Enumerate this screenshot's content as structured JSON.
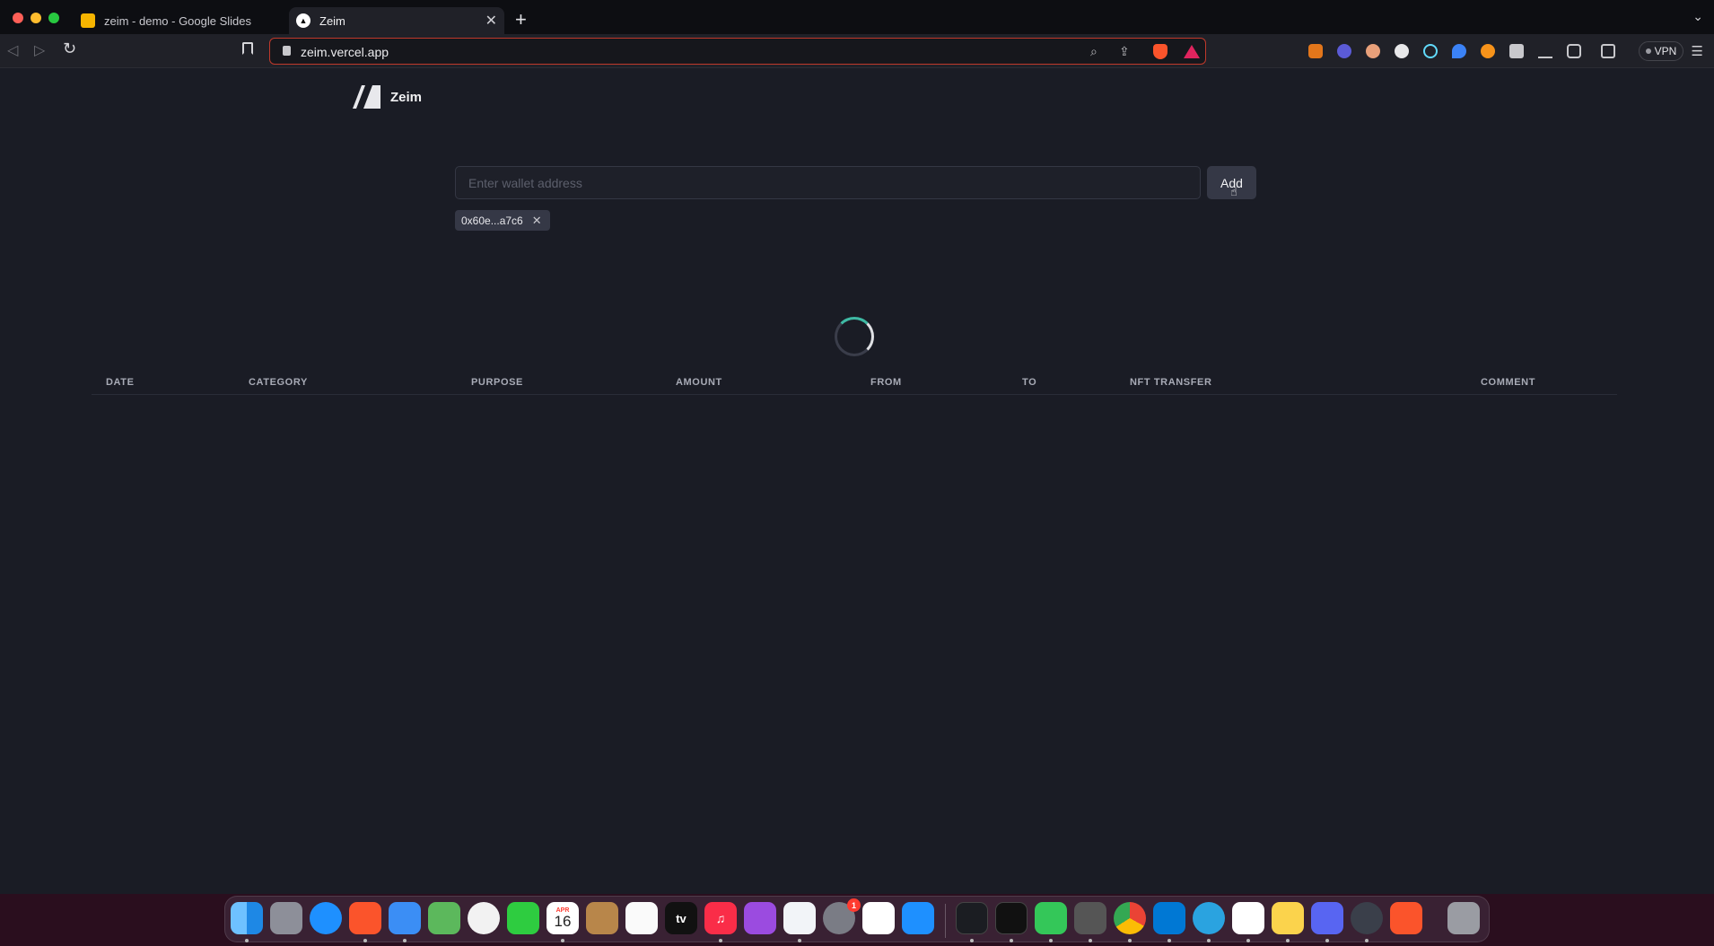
{
  "browser": {
    "tabs": [
      {
        "title": "zeim - demo - Google Slides"
      },
      {
        "title": "Zeim"
      }
    ],
    "url": "zeim.vercel.app",
    "vpn_label": "VPN"
  },
  "app": {
    "name": "Zeim",
    "wallet_input_placeholder": "Enter wallet address",
    "add_button_label": "Add",
    "wallet_chips": [
      {
        "address": "0x60e...a7c6"
      }
    ],
    "table_columns": [
      "DATE",
      "CATEGORY",
      "PURPOSE",
      "AMOUNT",
      "FROM",
      "TO",
      "NFT TRANSFER",
      "COMMENT"
    ],
    "accent_color": "#3fb9a4"
  },
  "dock": {
    "calendar_month": "APR",
    "calendar_day": "16",
    "tv_label": "tv",
    "settings_badge": "1",
    "apps": [
      "finder",
      "launchpad",
      "safari",
      "brave",
      "mail",
      "maps",
      "photos",
      "facetime",
      "calendar",
      "contacts",
      "reminders",
      "tv",
      "music",
      "podcasts",
      "keynote",
      "system-settings",
      "numbers",
      "app-store",
      "activity-monitor",
      "terminal",
      "messages",
      "keychain",
      "chrome",
      "vscode",
      "telegram",
      "slack",
      "notes",
      "discord",
      "quicktime",
      "brave-beta",
      "trash"
    ]
  }
}
